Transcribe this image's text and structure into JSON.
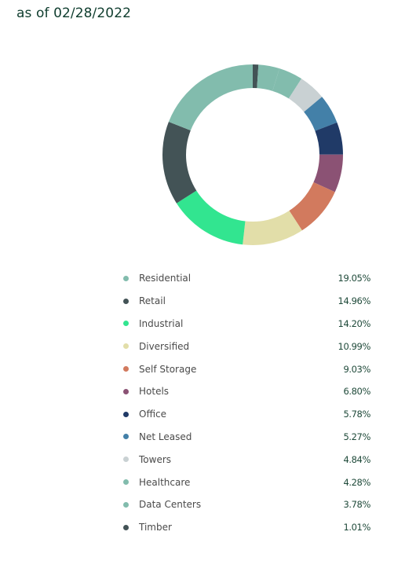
{
  "header": {
    "as_of": "as of 02/28/2022"
  },
  "chart_data": {
    "type": "pie",
    "subtype": "donut",
    "title": "as of 02/28/2022",
    "start": "top",
    "direction": "clockwise",
    "draw_order": [
      "Timber",
      "Data Centers",
      "Healthcare",
      "Towers",
      "Net Leased",
      "Office",
      "Hotels",
      "Self Storage",
      "Diversified",
      "Industrial",
      "Retail",
      "Residential"
    ],
    "legend_position": "bottom",
    "series": [
      {
        "name": "Residential",
        "value": 19.05,
        "label": "19.05%",
        "color": "#82bcad"
      },
      {
        "name": "Retail",
        "value": 14.96,
        "label": "14.96%",
        "color": "#435356"
      },
      {
        "name": "Industrial",
        "value": 14.2,
        "label": "14.20%",
        "color": "#32e590"
      },
      {
        "name": "Diversified",
        "value": 10.99,
        "label": "10.99%",
        "color": "#e2dea9"
      },
      {
        "name": "Self Storage",
        "value": 9.03,
        "label": "9.03%",
        "color": "#d27a5e"
      },
      {
        "name": "Hotels",
        "value": 6.8,
        "label": "6.80%",
        "color": "#8b5274"
      },
      {
        "name": "Office",
        "value": 5.78,
        "label": "5.78%",
        "color": "#203a67"
      },
      {
        "name": "Net Leased",
        "value": 5.27,
        "label": "5.27%",
        "color": "#4380a8"
      },
      {
        "name": "Towers",
        "value": 4.84,
        "label": "4.84%",
        "color": "#c9d1d3"
      },
      {
        "name": "Healthcare",
        "value": 4.28,
        "label": "4.28%",
        "color": "#82bcad"
      },
      {
        "name": "Data Centers",
        "value": 3.78,
        "label": "3.78%",
        "color": "#82bcad"
      },
      {
        "name": "Timber",
        "value": 1.01,
        "label": "1.01%",
        "color": "#435356"
      }
    ]
  }
}
